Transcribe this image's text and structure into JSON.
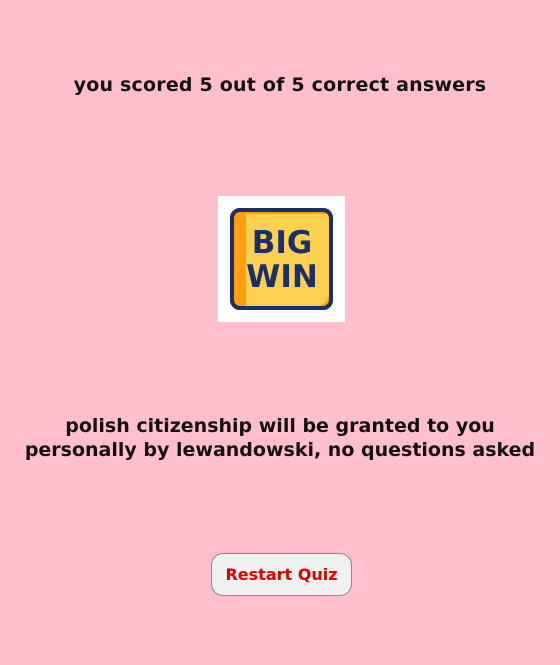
{
  "result": {
    "score_text": "you scored 5 out of 5 correct answers",
    "badge": {
      "icon": "big-win-icon",
      "line1": "BIG",
      "line2": "WIN"
    },
    "message": "polish citizenship will be granted to you personally by lewandowski, no questions asked"
  },
  "actions": {
    "restart_label": "Restart Quiz"
  },
  "colors": {
    "background": "#ffc0cb",
    "button_text": "#e00000",
    "badge_fill": "#ffb21e",
    "badge_outline": "#1b2f6b"
  }
}
